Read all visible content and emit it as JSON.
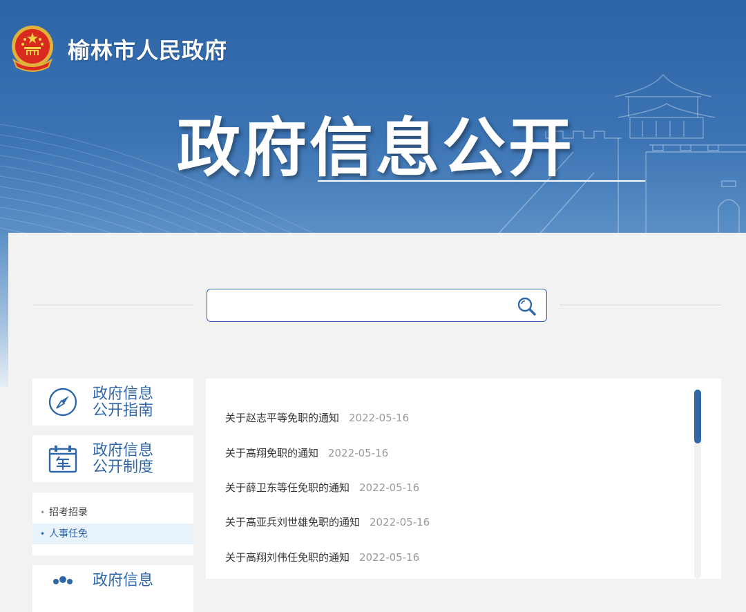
{
  "header": {
    "site_title": "榆林市人民政府",
    "hero_title": "政府信息公开"
  },
  "search": {
    "value": "",
    "placeholder": ""
  },
  "sidebar": {
    "cards": [
      {
        "line1": "政府信息",
        "line2": "公开指南",
        "icon": "compass-icon"
      },
      {
        "line1": "政府信息",
        "line2": "公开制度",
        "icon": "calendar-year-icon"
      },
      {
        "line1": "政府信息",
        "line2": "",
        "icon": "people-icon"
      }
    ],
    "submenu": [
      {
        "label": "招考招录",
        "active": false
      },
      {
        "label": "人事任免",
        "active": true
      }
    ]
  },
  "notices": [
    {
      "title": "关于赵志平等免职的通知",
      "date": "2022-05-16"
    },
    {
      "title": "关于高翔免职的通知",
      "date": "2022-05-16"
    },
    {
      "title": "关于薛卫东等任免职的通知",
      "date": "2022-05-16"
    },
    {
      "title": "关于高亚兵刘世雄免职的通知",
      "date": "2022-05-16"
    },
    {
      "title": "关于高翔刘伟任免职的通知",
      "date": "2022-05-16"
    }
  ],
  "colors": {
    "accent": "#2f67a8",
    "banner_top": "#2c64a6",
    "panel_bg": "#f2f2f2",
    "active_bg": "#e8f2fb"
  }
}
